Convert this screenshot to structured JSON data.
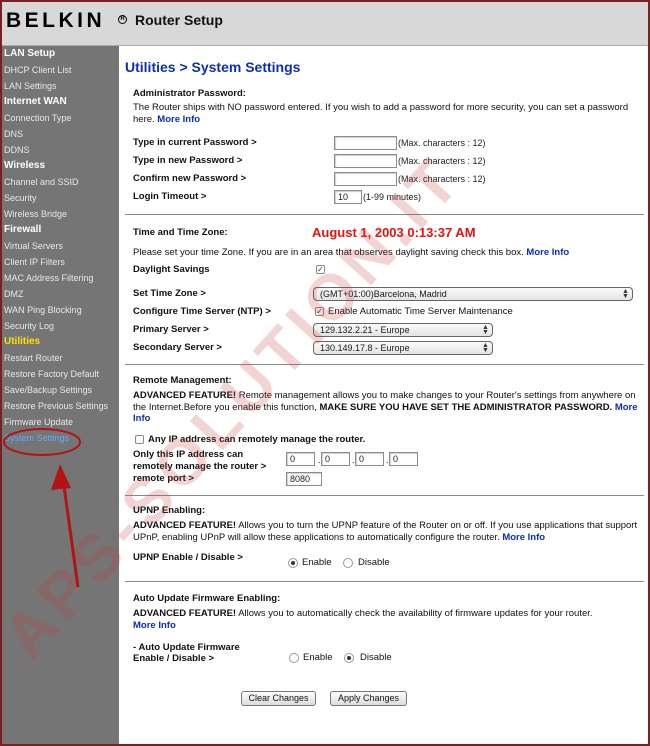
{
  "header": {
    "logo": "BELKIN",
    "registered_mark": "R",
    "title": "Router Setup"
  },
  "sidebar": {
    "groups": [
      {
        "heading": "LAN Setup",
        "items": [
          "DHCP Client List",
          "LAN Settings"
        ]
      },
      {
        "heading": "Internet WAN",
        "items": [
          "Connection Type",
          "DNS",
          "DDNS"
        ]
      },
      {
        "heading": "Wireless",
        "items": [
          "Channel and SSID",
          "Security",
          "Wireless Bridge"
        ]
      },
      {
        "heading": "Firewall",
        "items": [
          "Virtual Servers",
          "Client IP Filters",
          "MAC Address Filtering",
          "DMZ",
          "WAN Ping Blocking",
          "Security Log"
        ]
      },
      {
        "heading": "Utilities",
        "items": [
          "Restart Router",
          "Restore Factory Default",
          "Save/Backup Settings",
          "Restore Previous Settings",
          "Firmware Update",
          "System Settings"
        ]
      }
    ]
  },
  "page": {
    "title": "Utilities > System Settings"
  },
  "admin": {
    "title": "Administrator Password:",
    "desc": "The Router ships with NO password entered. If you wish to add a password for more security, you can set a password here.",
    "more": "More Info",
    "current_label": "Type in current Password >",
    "new_label": "Type in new Password >",
    "confirm_label": "Confirm new Password >",
    "timeout_label": "Login Timeout >",
    "max_hint": "(Max. characters : 12)",
    "timeout_value": "10",
    "timeout_hint": "(1-99 minutes)"
  },
  "time": {
    "title": "Time and Time Zone:",
    "date": "August 1, 2003 0:13:37 AM",
    "desc": "Please set your time Zone. If you are in an area that observes daylight saving check this box.",
    "more": "More Info",
    "daylight_label": "Daylight Savings",
    "daylight_checked": true,
    "tz_label": "Set Time Zone >",
    "tz_value": "(GMT+01:00)Barcelona, Madrid",
    "ntp_label": "Configure Time Server (NTP) >",
    "ntp_option": "Enable Automatic Time Server Maintenance",
    "ntp_checked": true,
    "primary_label": "Primary Server >",
    "primary_value": "129.132.2.21 - Europe",
    "secondary_label": "Secondary Server >",
    "secondary_value": "130.149.17.8 - Europe"
  },
  "remote": {
    "title": "Remote Management:",
    "adv": "ADVANCED FEATURE!",
    "desc": "Remote management allows you to make changes to your Router's settings from anywhere on the Internet.Before you enable this function,",
    "warn": "MAKE SURE YOU HAVE SET THE ADMINISTRATOR PASSWORD.",
    "more": "More Info",
    "any_ip_label": "Any IP address can remotely manage the router.",
    "only_ip_label_1": "Only this IP address can",
    "only_ip_label_2": "remotely manage the router >",
    "ip": [
      "0",
      "0",
      "0",
      "0"
    ],
    "port_label": "remote port >",
    "port_value": "8080"
  },
  "upnp": {
    "title": "UPNP Enabling:",
    "adv": "ADVANCED FEATURE!",
    "desc": "Allows you to turn the UPNP feature of the Router on or off. If you use applications that support UPnP, enabling UPnP will allow these applications to automatically configure the router.",
    "more": "More Info",
    "toggle_label": "UPNP Enable / Disable >",
    "enable": "Enable",
    "disable": "Disable",
    "selected": "Enable"
  },
  "firmware": {
    "title": "Auto Update Firmware Enabling:",
    "adv": "ADVANCED FEATURE!",
    "desc": "Allows you to automatically check the availability of firmware updates for your router.",
    "more": "More Info",
    "toggle_label_1": "- Auto Update Firmware",
    "toggle_label_2": "Enable / Disable >",
    "enable": "Enable",
    "disable": "Disable",
    "selected": "Disable"
  },
  "buttons": {
    "clear": "Clear Changes",
    "apply": "Apply Changes"
  },
  "watermark": "APS-SOLUTION.IT",
  "colors": {
    "title_blue": "#0b2fb0",
    "date_red": "#e8120f",
    "sidebar_bg": "#757575",
    "active_group": "#ffe000",
    "current_item": "#64a8ff",
    "annotation": "#b01515"
  }
}
